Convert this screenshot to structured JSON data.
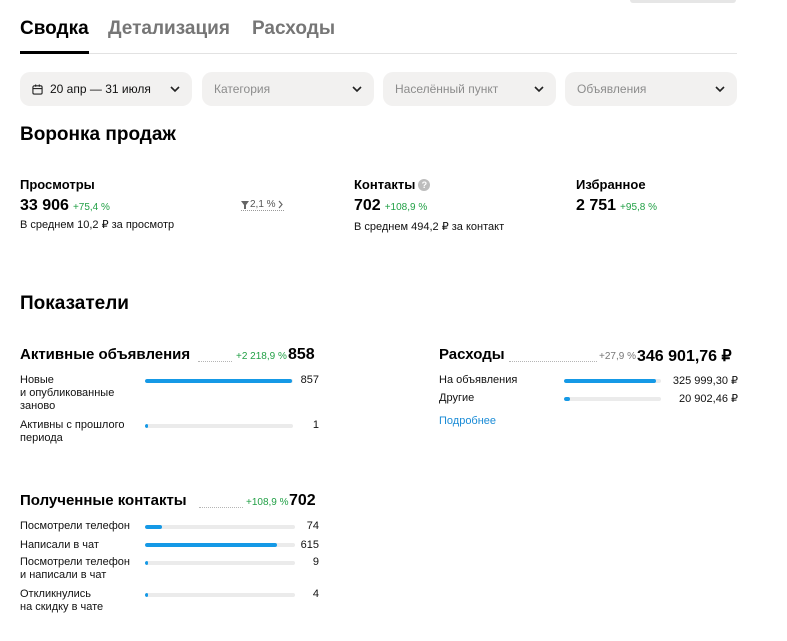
{
  "tabs": [
    {
      "label": "Сводка",
      "active": true
    },
    {
      "label": "Детализация",
      "active": false
    },
    {
      "label": "Расходы",
      "active": false
    }
  ],
  "filters": {
    "date": "20 апр — 31 июля",
    "category": "Категория",
    "city": "Населённый пункт",
    "ads": "Объявления"
  },
  "funnel": {
    "title": "Воронка продаж",
    "views": {
      "title": "Просмотры",
      "value": "33 906",
      "delta": "+75,4 %",
      "sub": "В среднем 10,2 ₽ за просмотр",
      "conversion": "2,1 %"
    },
    "contacts": {
      "title": "Контакты",
      "help": "?",
      "value": "702",
      "delta": "+108,9 %",
      "sub": "В среднем 494,2 ₽ за контакт"
    },
    "favorites": {
      "title": "Избранное",
      "value": "2 751",
      "delta": "+95,8 %"
    }
  },
  "indicators": {
    "title": "Показатели",
    "active_ads": {
      "title": "Активные объявления",
      "delta": "+2 218,9 %",
      "total": "858",
      "rows": [
        {
          "label": "Новые\nи опубликованные\nзаново",
          "value": "857",
          "fill": 0.99
        },
        {
          "label": "Активны с прошлого\nпериода",
          "value": "1",
          "fill": 0.02
        }
      ]
    },
    "expenses": {
      "title": "Расходы",
      "delta": "+27,9 %",
      "total": "346 901,76 ₽",
      "rows": [
        {
          "label": "На объявления",
          "value": "325 999,30 ₽",
          "fill": 0.95
        },
        {
          "label": "Другие",
          "value": "20 902,46 ₽",
          "fill": 0.06
        }
      ],
      "link": "Подробнее"
    },
    "received_contacts": {
      "title": "Полученные контакты",
      "delta": "+108,9 %",
      "total": "702",
      "rows": [
        {
          "label": "Посмотрели телефон",
          "value": "74",
          "fill": 0.11
        },
        {
          "label": "Написали в чат",
          "value": "615",
          "fill": 0.88
        },
        {
          "label": "Посмотрели телефон\nи написали в чат",
          "value": "9",
          "fill": 0.02
        },
        {
          "label": "Откликнулись\nна скидку в чате",
          "value": "4",
          "fill": 0.02
        }
      ]
    }
  },
  "colors": {
    "accent": "#1599e6",
    "positive": "#22a046",
    "link": "#1a8bd6"
  }
}
